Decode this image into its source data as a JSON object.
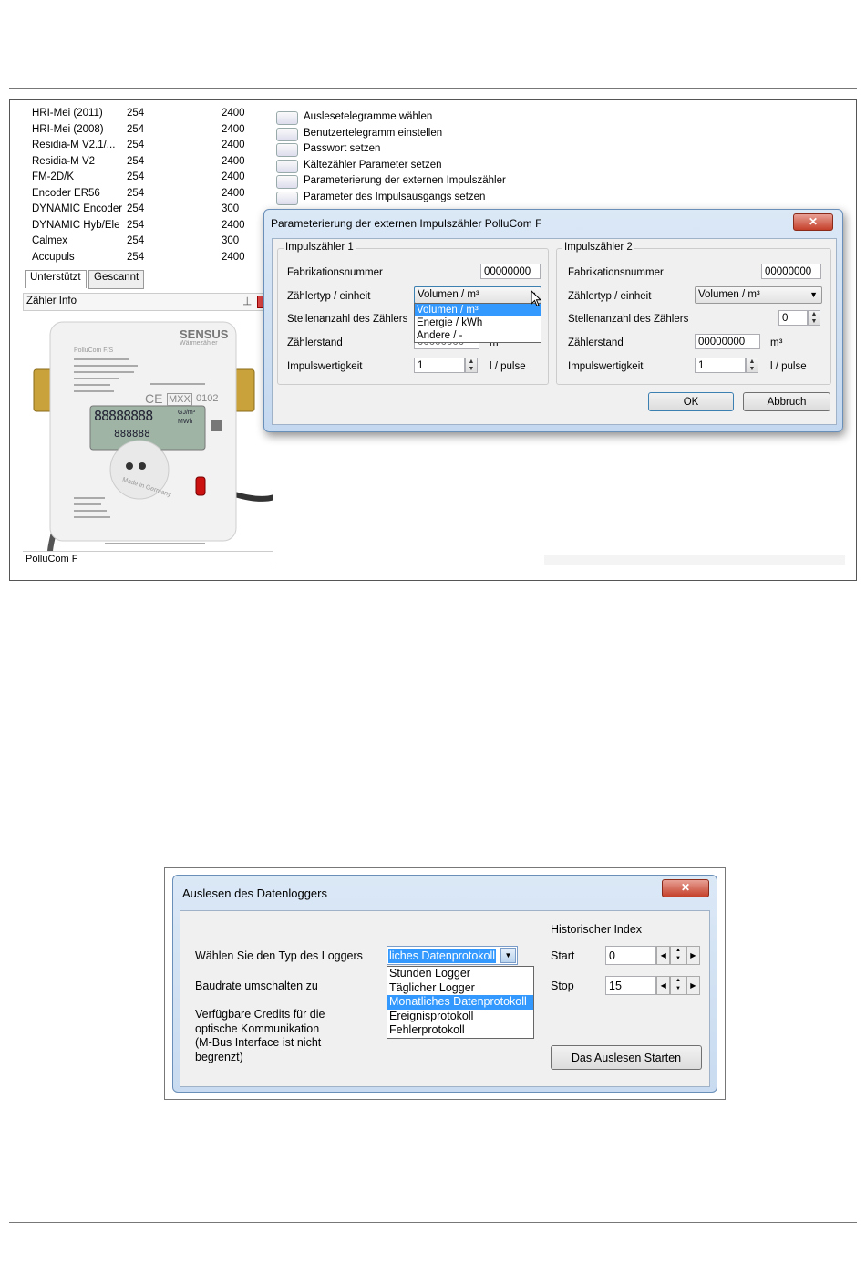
{
  "screenshot1": {
    "meter_list": [
      {
        "name": "HRI-Mei (2011)",
        "col2": "254",
        "col3": "2400"
      },
      {
        "name": "HRI-Mei (2008)",
        "col2": "254",
        "col3": "2400"
      },
      {
        "name": "Residia-M V2.1/...",
        "col2": "254",
        "col3": "2400"
      },
      {
        "name": "Residia-M V2",
        "col2": "254",
        "col3": "2400"
      },
      {
        "name": "FM-2D/K",
        "col2": "254",
        "col3": "2400"
      },
      {
        "name": "Encoder ER56",
        "col2": "254",
        "col3": "2400"
      },
      {
        "name": "DYNAMIC Encoder",
        "col2": "254",
        "col3": "300"
      },
      {
        "name": "DYNAMIC Hyb/Ele",
        "col2": "254",
        "col3": "2400"
      },
      {
        "name": "Calmex",
        "col2": "254",
        "col3": "300"
      },
      {
        "name": "Accupuls",
        "col2": "254",
        "col3": "2400"
      }
    ],
    "tabs": {
      "supported": "Unterstützt",
      "scanned": "Gescannt"
    },
    "meter_info_title": "Zähler Info",
    "pin_glyph": "⊣",
    "meter_caption": "PolluCom F",
    "device": {
      "brand": "SENSUS",
      "subbrand": "Wärmezähler",
      "model": "PolluCom F/S",
      "ce": "CE",
      "mark": "MXX",
      "nr": "0102",
      "made": "Made in Germany",
      "lcd_digits": "88888888",
      "lcd_units": "GJ/m³",
      "lcd_units2": "MWh",
      "lcd_digits2": "888888"
    },
    "commands": [
      "Auslesetelegramme wählen",
      "Benutzertelegramm einstellen",
      "Passwort setzen",
      "Kältezähler Parameter setzen",
      "Parameterierung der externen Impulszähler",
      "Parameter des Impulsausgangs setzen"
    ],
    "dialog": {
      "title": "Parameterierung der externen Impulszähler PolluCom F",
      "close_glyph": "✕",
      "group1": {
        "caption": "Impulszähler 1",
        "fabrication_label": "Fabrikationsnummer",
        "fabrication_value": "00000000",
        "type_label": "Zählertyp / einheit",
        "type_value": "Volumen / m³",
        "digits_label": "Stellenanzahl des Zählers",
        "counter_label": "Zählerstand",
        "counter_value": "00000000",
        "counter_unit": "m³",
        "impulse_label": "Impulswertigkeit",
        "impulse_value": "1",
        "impulse_unit": "l / pulse",
        "dropdown_options": [
          "Volumen / m³",
          "Energie / kWh",
          "Andere / -"
        ],
        "dropdown_selected": 0
      },
      "group2": {
        "caption": "Impulszähler 2",
        "fabrication_label": "Fabrikationsnummer",
        "fabrication_value": "00000000",
        "type_label": "Zählertyp / einheit",
        "type_value": "Volumen / m³",
        "digits_label": "Stellenanzahl des Zählers",
        "digits_value": "0",
        "counter_label": "Zählerstand",
        "counter_value": "00000000",
        "counter_unit": "m³",
        "impulse_label": "Impulswertigkeit",
        "impulse_value": "1",
        "impulse_unit": "l / pulse"
      },
      "ok": "OK",
      "cancel": "Abbruch"
    }
  },
  "screenshot2": {
    "title": "Auslesen des Datenloggers",
    "close_glyph": "✕",
    "logger_type_label": "Wählen Sie den Typ des Loggers",
    "logger_type_value": "liches Datenprotokoll",
    "baud_label": "Baudrate umschalten zu",
    "credits_label": [
      "Verfügbare Credits für die",
      "optische Kommunikation",
      "(M-Bus Interface ist nicht",
      "begrenzt)"
    ],
    "dropdown_options": [
      "Stunden Logger",
      "Täglicher Logger",
      "Monatliches Datenprotokoll",
      "Ereignisprotokoll",
      "Fehlerprotokoll"
    ],
    "dropdown_selected": 2,
    "index_title": "Historischer Index",
    "start_label": "Start",
    "start_value": "0",
    "stop_label": "Stop",
    "stop_value": "15",
    "start_button": "Das Auslesen Starten"
  }
}
